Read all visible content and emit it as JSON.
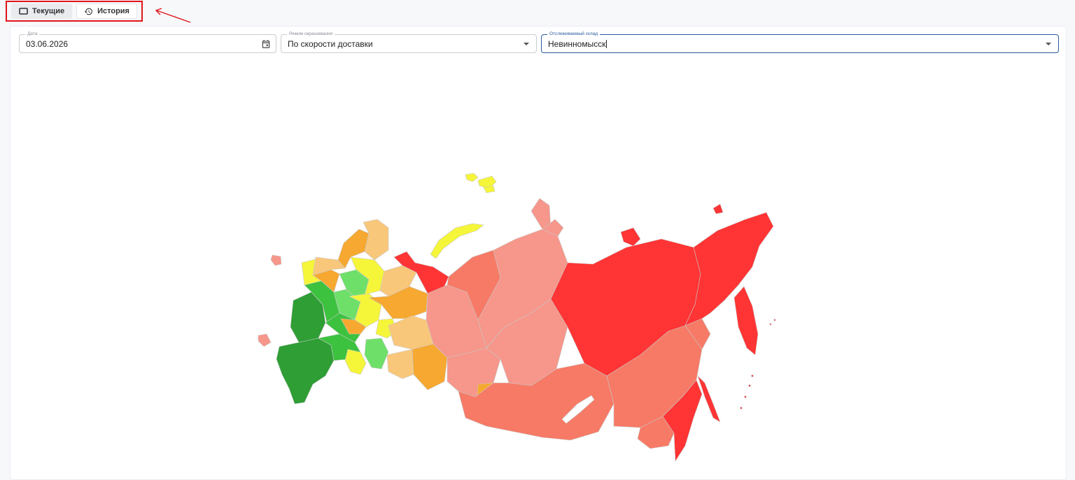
{
  "tabs": [
    {
      "label": "Текущие",
      "icon": "monitor-icon",
      "active": true
    },
    {
      "label": "История",
      "icon": "history-icon",
      "active": false
    }
  ],
  "filters": {
    "date": {
      "label": "Дата",
      "value": "03.06.2026",
      "icon": "calendar-icon"
    },
    "mode": {
      "label": "Режим окрашивания",
      "value": "По скорости доставки"
    },
    "warehouse": {
      "label": "Отслеживаемый склад",
      "value": "Невинномысск"
    }
  },
  "colors": {
    "annotation": "#e0141c",
    "fastest": "#2e9e35",
    "fast": "#3cc23f",
    "good": "#6ee06a",
    "medium": "#f5f53a",
    "slow": "#f9c77a",
    "slower": "#f7a830",
    "far": "#f7968a",
    "farther": "#f77a66",
    "farthest": "#ff3434"
  }
}
